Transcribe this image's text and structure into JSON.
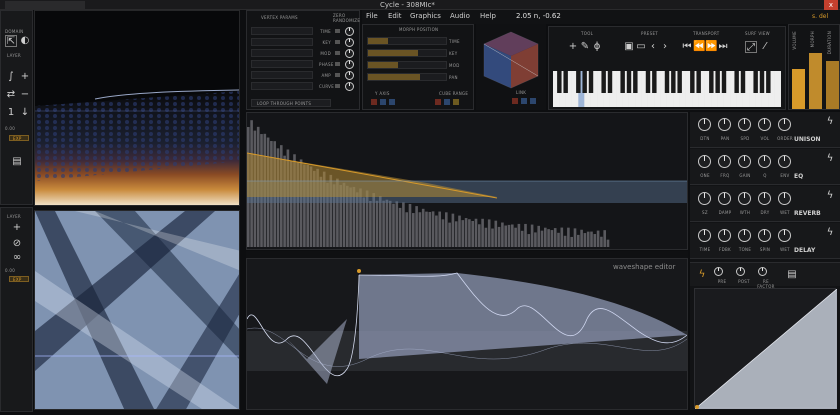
{
  "window": {
    "title": "Cycle - 308MIc*",
    "close_glyph": "x",
    "top_right_label": "s. del"
  },
  "menu": {
    "items": [
      "File",
      "Edit",
      "Graphics",
      "Audio",
      "Help"
    ]
  },
  "status": {
    "cursor_readout": "2.05 n, -0.62"
  },
  "left_toolbar": {
    "top_label": "DOMAIN",
    "layer_label": "LAYER",
    "unknown_label": "0.00",
    "ex_label": "EXP",
    "bottom_layer_label": "LAYER",
    "bottom_unknown_label": "0.00",
    "bottom_ex_label": "EXP"
  },
  "param_panel": {
    "header_left": "VERTEX PARAMS",
    "header_right": "ZERO RANDOMIZE",
    "rows": [
      "TIME",
      "KEY",
      "MOD",
      "PHASE",
      "AMP",
      "CURVE"
    ],
    "footer": "LOOP THROUGH POINTS"
  },
  "morph_panel": {
    "header": "MORPH POSITION",
    "rows": [
      "TIME",
      "KEY",
      "MOD",
      "PAN"
    ],
    "section_labels": [
      "Y AXIS",
      "CUBE RANGE",
      "LINK"
    ]
  },
  "tool_panel": {
    "groups": [
      "TOOL",
      "PRESET",
      "TRANSPORT",
      "SURF VIEW"
    ],
    "tool_icons": [
      "plus-icon",
      "pencil-icon",
      "brush-icon"
    ],
    "preset_icons": [
      "save-icon",
      "folder-icon",
      "chevron-left-icon",
      "chevron-right-icon"
    ],
    "transport_icons": [
      "skip-back-icon",
      "rewind-icon",
      "fast-forward-icon",
      "skip-forward-icon"
    ]
  },
  "meters": {
    "labels": [
      "VOLUME",
      "MORPH",
      "DURATION"
    ]
  },
  "waveshape": {
    "title": "waveshape editor"
  },
  "effects": {
    "unison": {
      "title": "UNISON",
      "knobs": [
        "DTN",
        "PAN",
        "SPD",
        "VOL",
        "ORDER"
      ]
    },
    "eq": {
      "title": "EQ",
      "knobs": [
        "ONE",
        "FRQ",
        "GAIN",
        "Q",
        "ENV"
      ]
    },
    "reverb": {
      "title": "REVERB",
      "knobs": [
        "SZ",
        "DAMP",
        "WTH",
        "DRY",
        "WET"
      ]
    },
    "delay": {
      "title": "DELAY",
      "knobs": [
        "TIME",
        "FDBK",
        "TONE",
        "SPIN",
        "WET"
      ]
    },
    "bottom": {
      "knobs": [
        "PRE",
        "POST",
        "RE FACTOR"
      ]
    }
  },
  "colors": {
    "accent_orange": "#d89a2a",
    "accent_blue": "#7d9ec2",
    "panel": "#18191b",
    "bg": "#0d0e10"
  }
}
